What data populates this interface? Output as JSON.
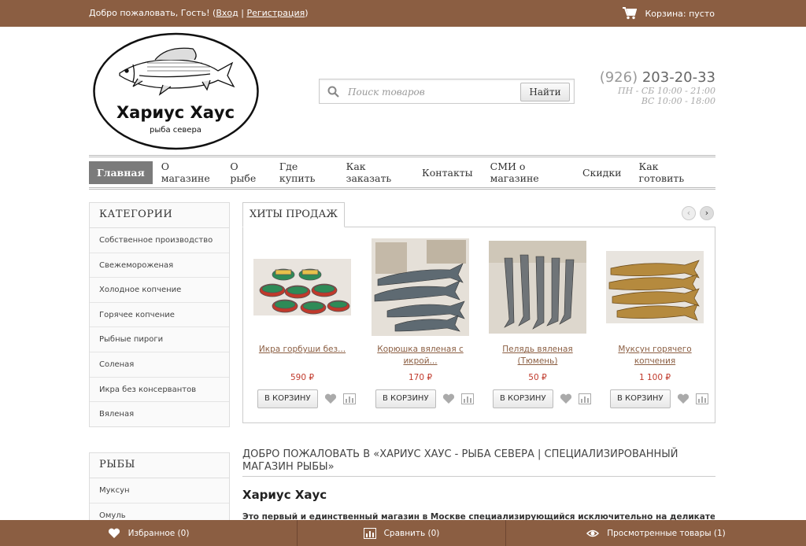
{
  "topbar": {
    "welcome_prefix": "Добро пожаловать, Гость! (",
    "login": "Вход",
    "separator": " | ",
    "register": "Регистрация",
    "welcome_suffix": ")",
    "cart_label": "Корзина: пусто"
  },
  "brand": {
    "name": "Хариус Хаус",
    "tagline": "рыба севера"
  },
  "search": {
    "placeholder": "Поиск товаров",
    "button": "Найти"
  },
  "contacts": {
    "phone_code": "(926)",
    "phone_number": "203-20-33",
    "hours_weekdays": "ПН - СБ 10:00 - 21:00",
    "hours_sunday": "ВС 10:00 - 18:00"
  },
  "nav": {
    "items": [
      "Главная",
      "О магазине",
      "О рыбе",
      "Где купить",
      "Как заказать",
      "Контакты",
      "СМИ о магазине",
      "Скидки",
      "Как готовить"
    ]
  },
  "categories": {
    "title": "КАТЕГОРИИ",
    "items": [
      "Собственное производство",
      "Свежемороженая",
      "Холодное копчение",
      "Горячее копчение",
      "Рыбные пироги",
      "Соленая",
      "Икра без консервантов",
      "Вяленая"
    ]
  },
  "fish": {
    "title": "РЫБЫ",
    "items": [
      "Муксун",
      "Омуль"
    ]
  },
  "hits": {
    "title": "ХИТЫ ПРОДАЖ",
    "prev": "‹",
    "next": "›",
    "products": [
      {
        "name_line1": "Икра горбуши без...",
        "name_line2": "",
        "price": "590 ₽",
        "buy": "В КОРЗИНУ"
      },
      {
        "name_line1": "Корюшка вяленая с",
        "name_line2": "икрой...",
        "price": "170 ₽",
        "buy": "В КОРЗИНУ"
      },
      {
        "name_line1": "Пелядь вяленая (Тюмень)",
        "name_line2": "",
        "price": "50 ₽",
        "buy": "В КОРЗИНУ"
      },
      {
        "name_line1": "Муксун горячего",
        "name_line2": "копчения",
        "price": "1 100 ₽",
        "buy": "В КОРЗИНУ"
      }
    ]
  },
  "welcome": {
    "title": "ДОБРО ПОЖАЛОВАТЬ В «ХАРИУС ХАУС - РЫБА СЕВЕРА | СПЕЦИАЛИЗИРОВАННЫЙ МАГАЗИН РЫБЫ»",
    "heading": "Хариус Хаус",
    "text": "Это первый и единственный магазин в Москве специализирующийся исключительно на деликатесной"
  },
  "bottombar": {
    "favorites": "Избранное (0)",
    "compare": "Сравнить (0)",
    "viewed": "Просмотренные товары (1)"
  },
  "colors": {
    "brand_brown": "#8b5e42",
    "price_red": "#c0392b",
    "nav_active": "#7b7b7b"
  }
}
